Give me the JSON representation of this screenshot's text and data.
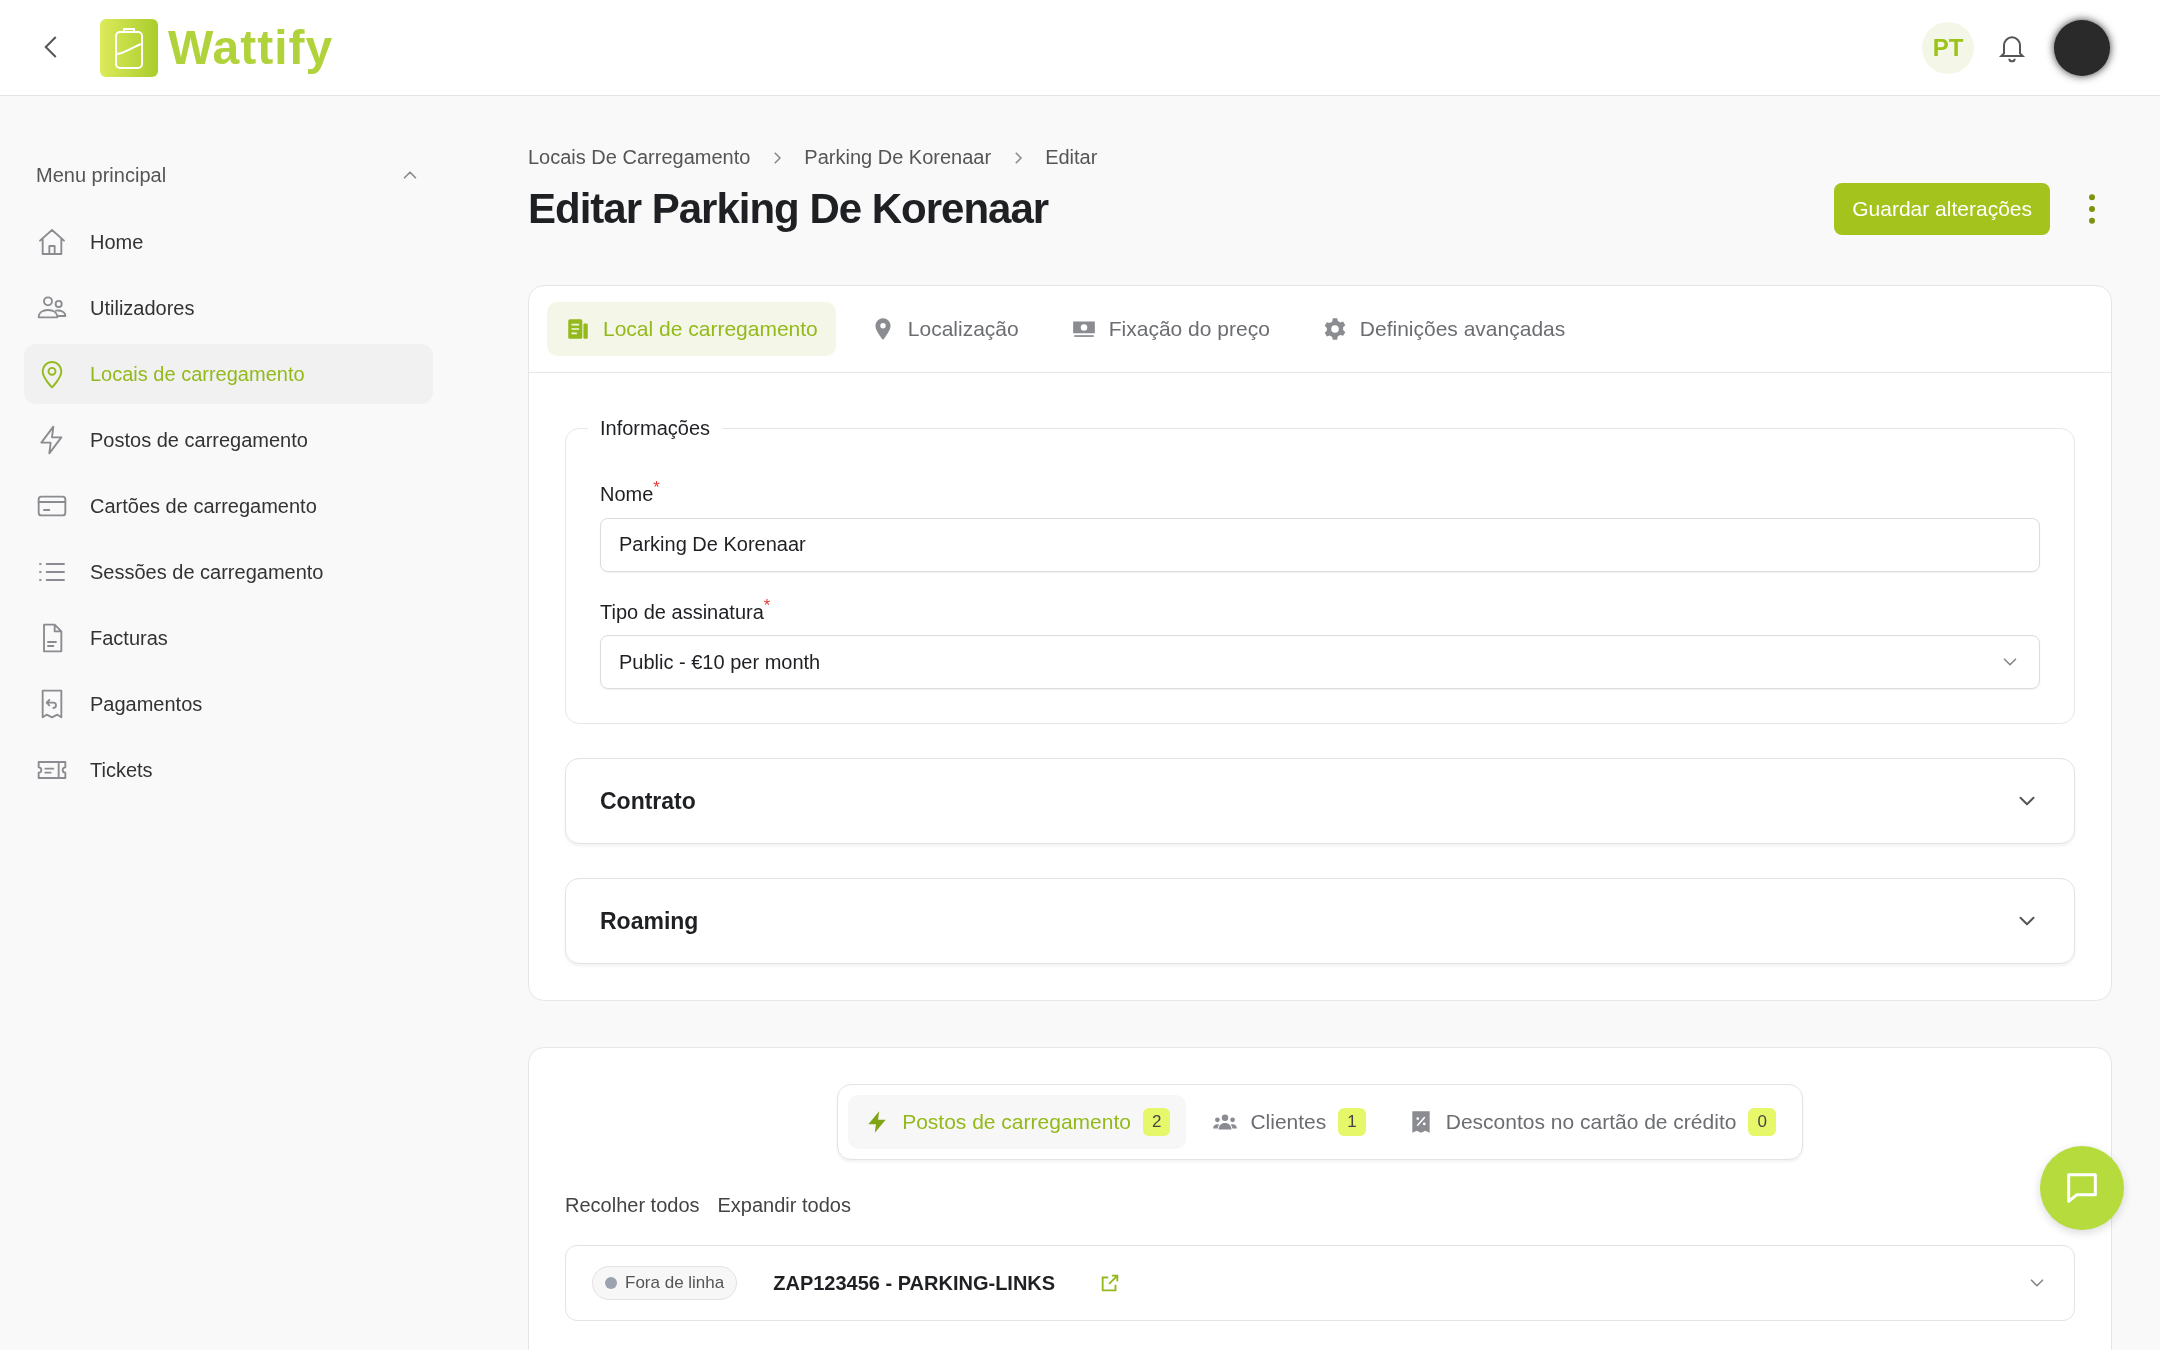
{
  "header": {
    "logo": "Wattify",
    "language": "PT"
  },
  "sidebar": {
    "title": "Menu principal",
    "expanded": true,
    "items": [
      {
        "label": "Home",
        "selected": false
      },
      {
        "label": "Utilizadores",
        "selected": false
      },
      {
        "label": "Locais de carregamento",
        "selected": true
      },
      {
        "label": "Postos de carregamento",
        "selected": false
      },
      {
        "label": "Cartões de carregamento",
        "selected": false
      },
      {
        "label": "Sessões de carregamento",
        "selected": false
      },
      {
        "label": "Facturas",
        "selected": false
      },
      {
        "label": "Pagamentos",
        "selected": false
      },
      {
        "label": "Tickets",
        "selected": false
      }
    ]
  },
  "breadcrumb": [
    "Locais De Carregamento",
    "Parking De Korenaar",
    "Editar"
  ],
  "title": "Editar Parking De Korenaar",
  "save_button": "Guardar alterações",
  "tabs": [
    {
      "label": "Local de carregamento",
      "selected": true
    },
    {
      "label": "Localização",
      "selected": false
    },
    {
      "label": "Fixação do preço",
      "selected": false
    },
    {
      "label": "Definições avançadas",
      "selected": false
    }
  ],
  "info": {
    "legend": "Informações",
    "required_mark": "*",
    "fields": [
      {
        "kind": "text",
        "label": "Nome",
        "required": true,
        "value": "Parking De Korenaar"
      },
      {
        "kind": "select",
        "label": "Tipo de assinatura",
        "required": true,
        "value": "Public - €10 per month"
      }
    ]
  },
  "sections": [
    {
      "title": "Contrato",
      "expanded": false
    },
    {
      "title": "Roaming",
      "expanded": false
    }
  ],
  "sub_tabs": [
    {
      "label": "Postos de carregamento",
      "count": "2",
      "selected": true
    },
    {
      "label": "Clientes",
      "count": "1",
      "selected": false
    },
    {
      "label": "Descontos no cartão de crédito",
      "count": "0",
      "selected": false
    }
  ],
  "actions": [
    "Recolher todos",
    "Expandir todos"
  ],
  "stations": [
    {
      "status": "Fora de linha",
      "color": "#9ca3af",
      "name": "ZAP123456 - PARKING-LINKS",
      "expanded": false
    }
  ]
}
